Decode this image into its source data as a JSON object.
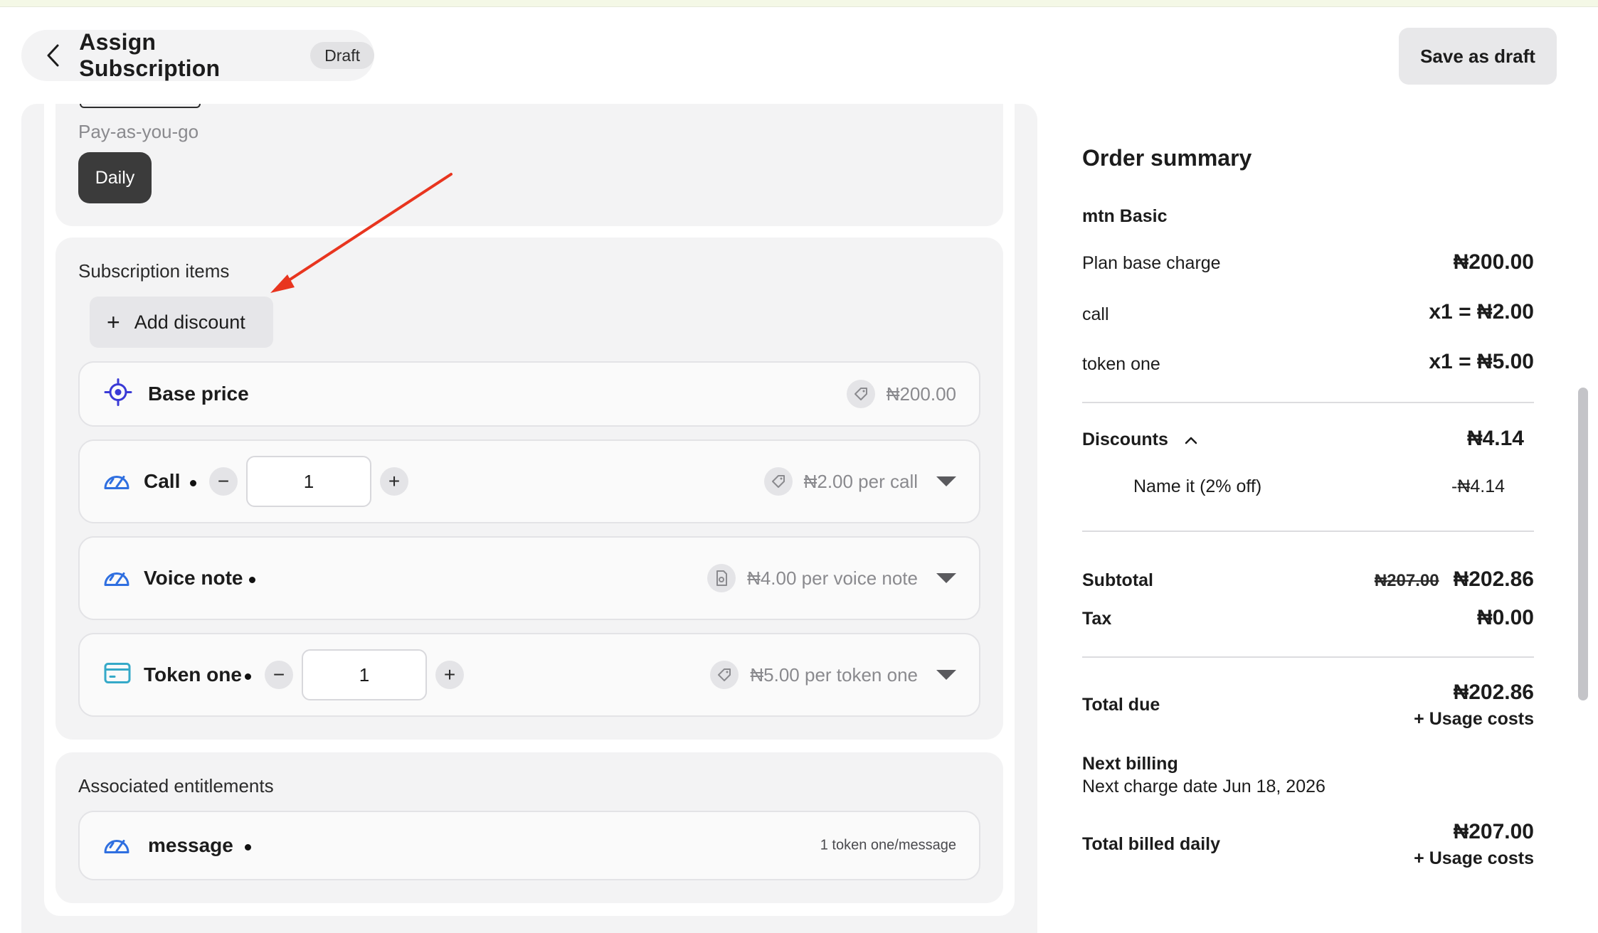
{
  "header": {
    "title": "Assign Subscription",
    "badge": "Draft",
    "save_label": "Save as draft"
  },
  "plan": {
    "payg_label": "Pay-as-you-go",
    "billing_option": "Daily"
  },
  "subscription_items": {
    "title": "Subscription items",
    "add_discount_label": "Add discount",
    "base": {
      "label": "Base price",
      "price": "₦200.00"
    },
    "items": [
      {
        "label": "Call",
        "qty": "1",
        "price": "₦2.00 per call"
      },
      {
        "label": "Voice note",
        "price": "₦4.00 per voice note"
      },
      {
        "label": "Token one",
        "qty": "1",
        "price": "₦5.00 per token one"
      }
    ]
  },
  "entitlements": {
    "title": "Associated entitlements",
    "items": [
      {
        "label": "message",
        "detail": "1 token one/message"
      }
    ]
  },
  "summary": {
    "title": "Order summary",
    "plan_name": "mtn Basic",
    "lines": [
      {
        "label": "Plan base charge",
        "value": "₦200.00"
      },
      {
        "label": "call",
        "value": "x1 = ₦2.00"
      },
      {
        "label": "token one",
        "value": "x1 = ₦5.00"
      }
    ],
    "discounts_label": "Discounts",
    "discounts_total": "₦4.14",
    "discount_name": "Name it (2% off)",
    "discount_value": "-₦4.14",
    "subtotal_label": "Subtotal",
    "subtotal_original": "₦207.00",
    "subtotal_value": "₦202.86",
    "tax_label": "Tax",
    "tax_value": "₦0.00",
    "total_due_label": "Total due",
    "total_due_value": "₦202.86",
    "total_due_extra": "+ Usage costs",
    "next_billing_label": "Next billing",
    "next_billing_text": "Next charge date Jun 18, 2026",
    "total_billed_label": "Total billed daily",
    "total_billed_value": "₦207.00",
    "total_billed_extra": "+ Usage costs"
  },
  "colors": {
    "accent_blue": "#2f6fe0",
    "base_icon": "#3a3ad6",
    "token_icon": "#35a9c8",
    "arrow": "#e8351f"
  },
  "icons": {
    "back": "chevron-left-icon",
    "base": "target-icon",
    "meter": "gauge-icon",
    "token": "card-icon",
    "price_tag": "tag-icon",
    "expand": "caret-down-icon"
  }
}
